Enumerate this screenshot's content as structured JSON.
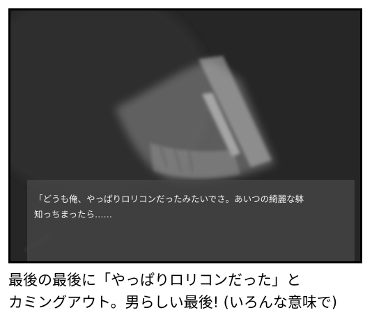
{
  "dialogue": {
    "line1": "「どうも俺、やっぱりロリコンだったみたいでさ。あいつの綺麗な躰",
    "line2": "知っちまったら……"
  },
  "caption": {
    "line1": "最後の最後に「やっぱりロリコンだった」と",
    "line2": "カミングアウト。男らしい最後! (いろんな意味で)"
  },
  "colors": {
    "frame_border": "#000000",
    "scene_dark": "#2a2a2a",
    "message_text": "#f2f2f2",
    "caption_text": "#000000"
  }
}
